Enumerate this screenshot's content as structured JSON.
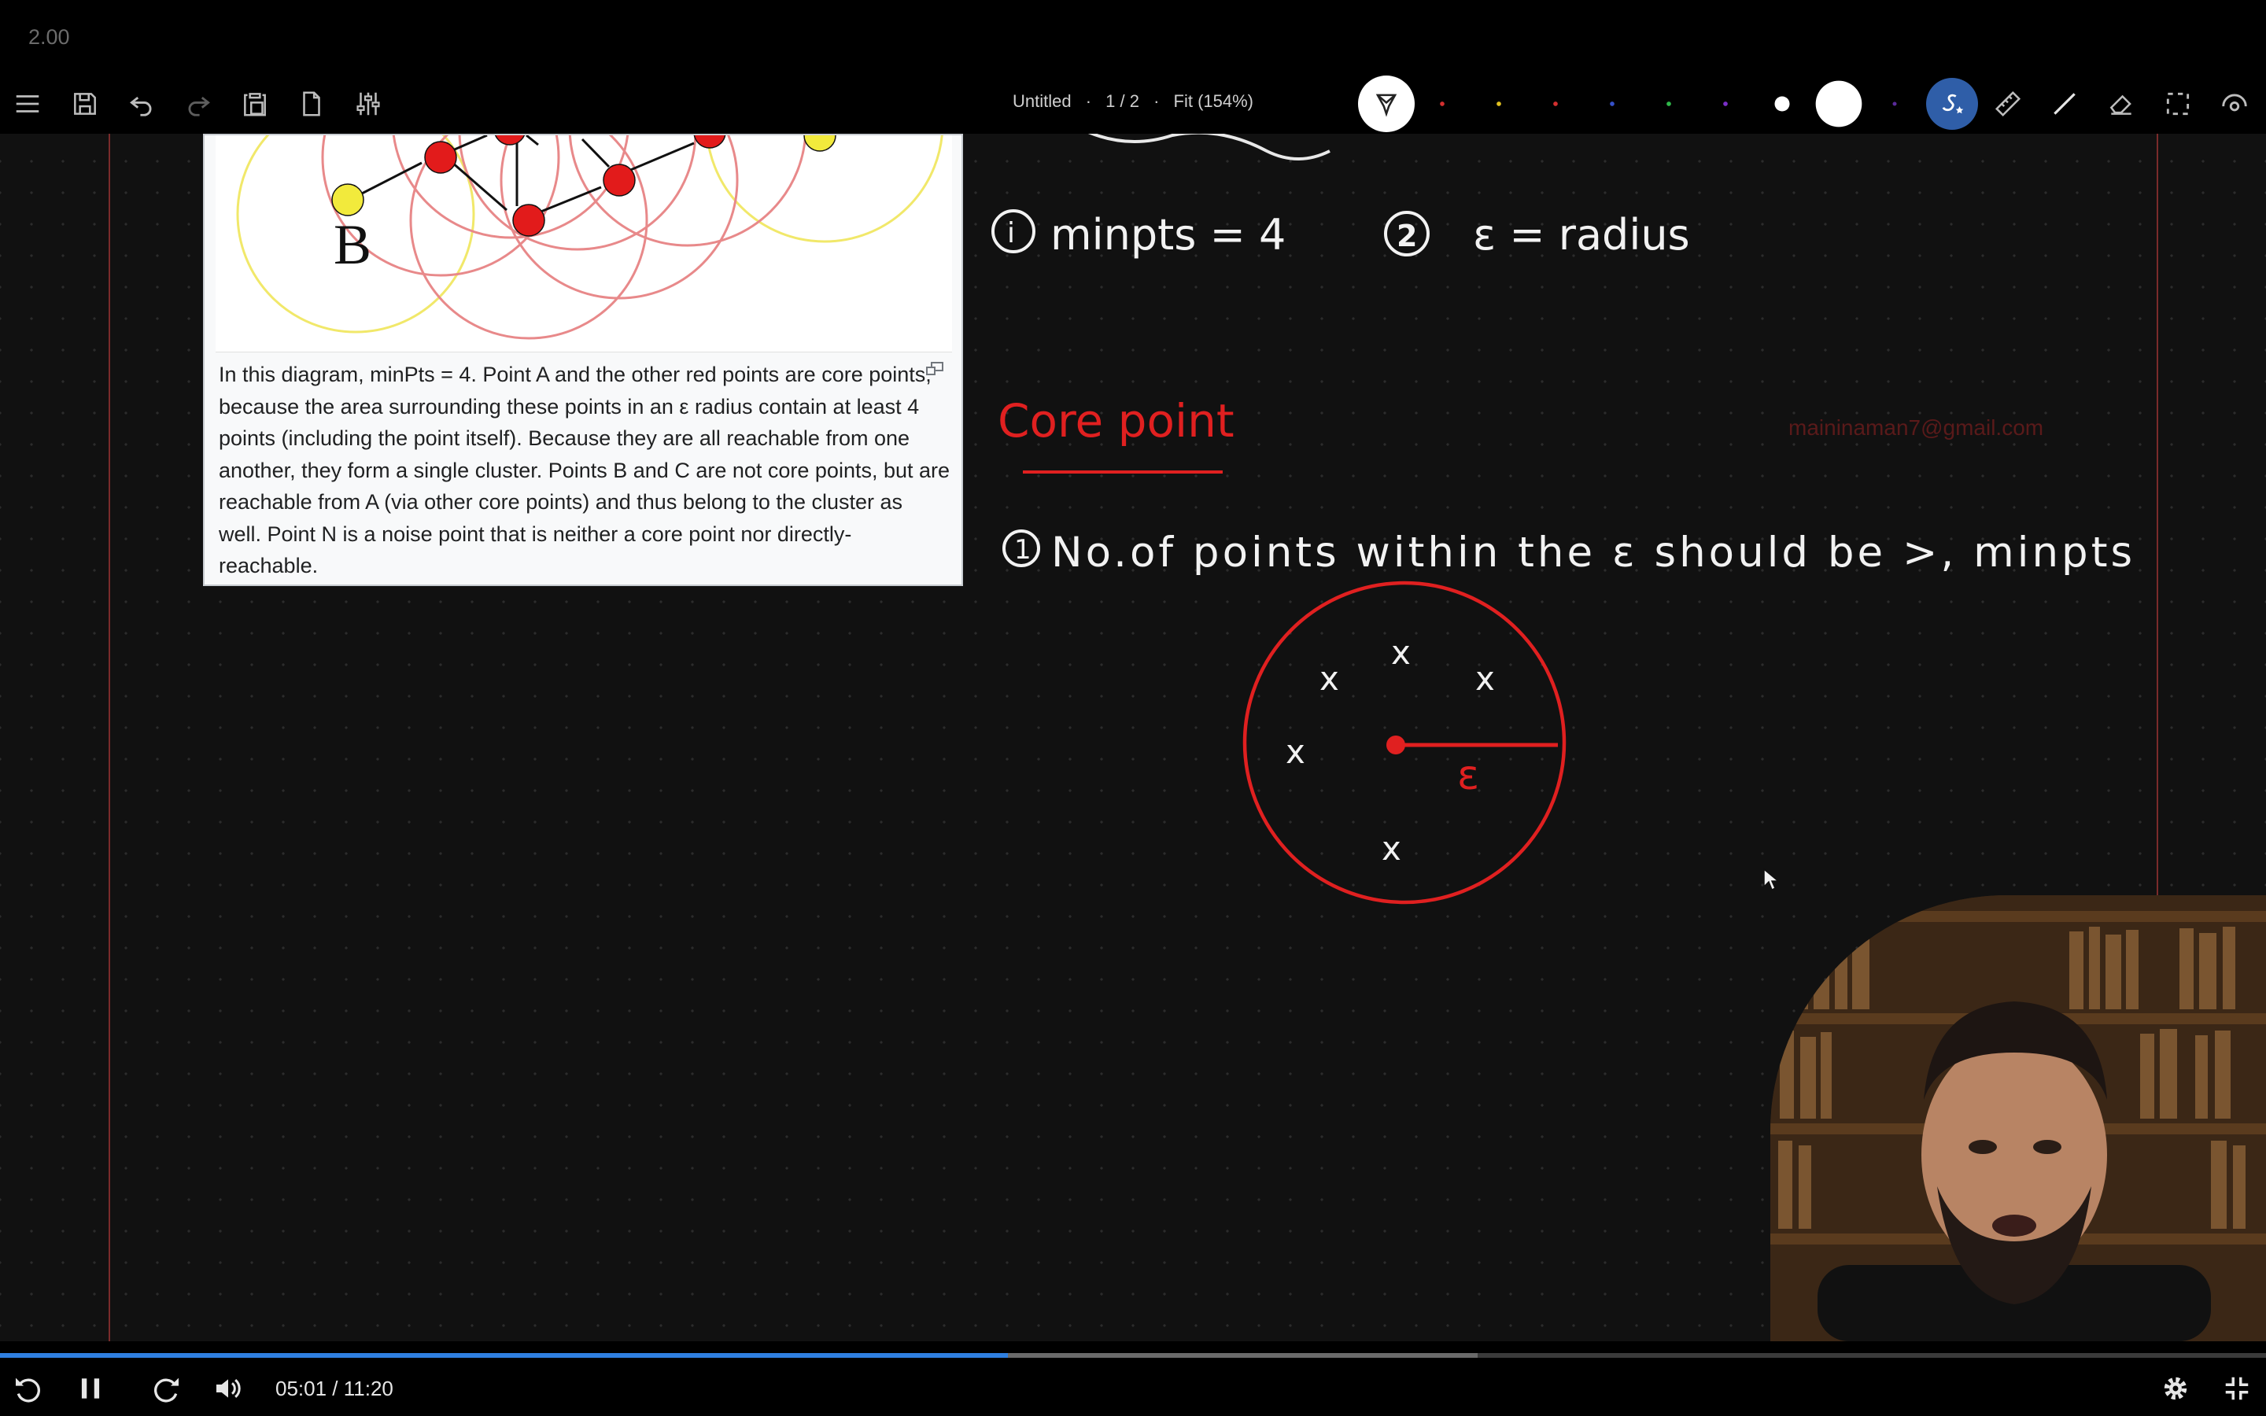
{
  "top": {
    "speed": "2.00"
  },
  "toolbar": {
    "doc_title": "Untitled",
    "sep1": "·",
    "page": "1 / 2",
    "sep2": "·",
    "zoom": "Fit (154%)"
  },
  "pen_colors": [
    "#d32f2f",
    "#e0c020",
    "#d32f2f",
    "#3550c8",
    "#2fb84a",
    "#7a2fc8"
  ],
  "wiki": {
    "label_b": "B",
    "caption": "In this diagram, minPts = 4. Point A and the other red points are core points, because the area surrounding these points in an ε radius contain at least 4 points (including the point itself). Because they are all reachable from one another, they form a single cluster. Points B and C are not core points, but are reachable from A (via other core points) and thus belong to the cluster as well. Point N is a noise point that is neither a core point nor directly-reachable."
  },
  "notes": {
    "line1_num": "i",
    "line1": "minpts = 4",
    "line2_num": "2",
    "line2": "ε = radius",
    "heading": "Core point",
    "rule_num": "1",
    "rule": "No.of points within the ε should be >, minpts",
    "marks": [
      "x",
      "x",
      "x",
      "x",
      "x"
    ],
    "eps_label": "ε"
  },
  "watermark": {
    "email": "maininaman7@gmail.com"
  },
  "player": {
    "time": "05:01 / 11:20",
    "progress": 0.4447,
    "buffered": 0.652
  }
}
